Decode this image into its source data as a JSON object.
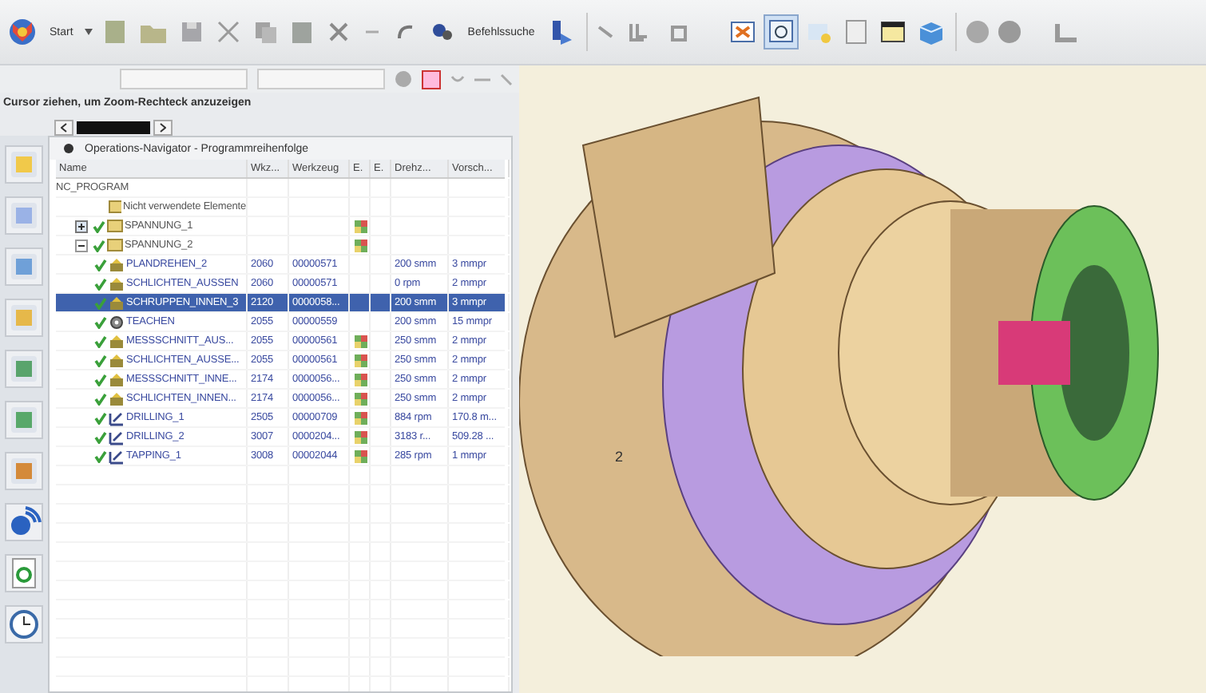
{
  "toolbar": {
    "start_label": "Start",
    "command_search_label": "Befehlssuche",
    "zoom_tool_selected": true
  },
  "hint": "Cursor ziehen, um Zoom-Rechteck anzuzeigen",
  "navigator": {
    "title": "Operations-Navigator - Programmreihenfolge",
    "columns": [
      "Name",
      "Wkz...",
      "Werkzeug",
      "E.",
      "E.",
      "Drehz...",
      "Vorsch..."
    ],
    "tree": {
      "name": "NC_PROGRAM",
      "children": [
        {
          "name": "Nicht verwendete Elemente",
          "kind": "group"
        },
        {
          "name": "SPANNUNG_1",
          "kind": "group",
          "checked": true,
          "expanded": false,
          "path_icon": true
        },
        {
          "name": "SPANNUNG_2",
          "kind": "group",
          "checked": true,
          "expanded": true,
          "path_icon": true,
          "children": [
            {
              "name": "PLANDREHEN_2",
              "kind": "turning",
              "checked": true,
              "selected": false,
              "wkz": "2060",
              "tool": "00000571",
              "path_icon": false,
              "speed": "200 smm",
              "feed": "3 mmpr"
            },
            {
              "name": "SCHLICHTEN_AUSSEN",
              "kind": "turning",
              "checked": true,
              "selected": false,
              "wkz": "2060",
              "tool": "00000571",
              "path_icon": false,
              "speed": "0 rpm",
              "feed": "2 mmpr"
            },
            {
              "name": "SCHRUPPEN_INNEN_3",
              "kind": "turning",
              "checked": true,
              "selected": true,
              "wkz": "2120",
              "tool": "0000058...",
              "path_icon": false,
              "speed": "200 smm",
              "feed": "3 mmpr"
            },
            {
              "name": "TEACHEN",
              "kind": "teach",
              "checked": true,
              "selected": false,
              "wkz": "2055",
              "tool": "00000559",
              "path_icon": false,
              "speed": "200 smm",
              "feed": "15 mmpr"
            },
            {
              "name": "MESSSCHNITT_AUS...",
              "kind": "turning",
              "checked": true,
              "selected": false,
              "wkz": "2055",
              "tool": "00000561",
              "path_icon": true,
              "speed": "250 smm",
              "feed": "2 mmpr"
            },
            {
              "name": "SCHLICHTEN_AUSSE...",
              "kind": "turning",
              "checked": true,
              "selected": false,
              "wkz": "2055",
              "tool": "00000561",
              "path_icon": true,
              "speed": "250 smm",
              "feed": "2 mmpr"
            },
            {
              "name": "MESSSCHNITT_INNE...",
              "kind": "turning",
              "checked": true,
              "selected": false,
              "wkz": "2174",
              "tool": "0000056...",
              "path_icon": true,
              "speed": "250 smm",
              "feed": "2 mmpr"
            },
            {
              "name": "SCHLICHTEN_INNEN...",
              "kind": "turning",
              "checked": true,
              "selected": false,
              "wkz": "2174",
              "tool": "0000056...",
              "path_icon": true,
              "speed": "250 smm",
              "feed": "2 mmpr"
            },
            {
              "name": "DRILLING_1",
              "kind": "drilling",
              "checked": true,
              "selected": false,
              "wkz": "2505",
              "tool": "00000709",
              "path_icon": true,
              "speed": "884 rpm",
              "feed": "170.8 m..."
            },
            {
              "name": "DRILLING_2",
              "kind": "drilling",
              "checked": true,
              "selected": false,
              "wkz": "3007",
              "tool": "0000204...",
              "path_icon": true,
              "speed": "3183 r...",
              "feed": "509.28 ..."
            },
            {
              "name": "TAPPING_1",
              "kind": "drilling",
              "checked": true,
              "selected": false,
              "wkz": "3008",
              "tool": "00002044",
              "path_icon": true,
              "speed": "285 rpm",
              "feed": "1 mmpr"
            }
          ]
        }
      ]
    }
  },
  "viewport": {
    "label": "2"
  }
}
